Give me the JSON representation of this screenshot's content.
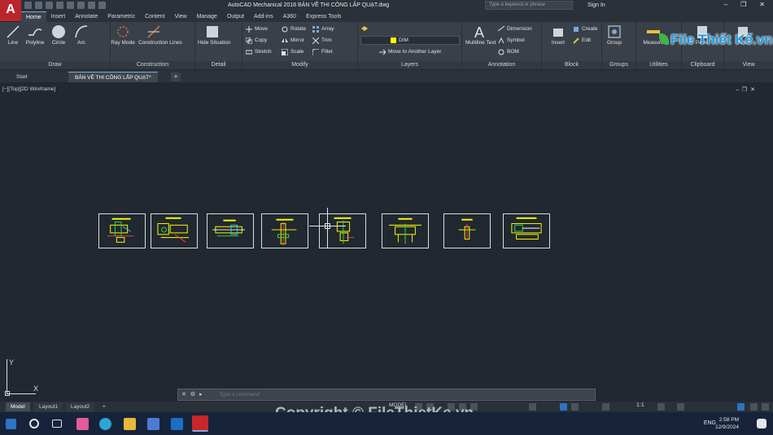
{
  "app": {
    "logo": "A",
    "title": "AutoCAD Mechanical 2018    BẢN VẼ THI CÔNG LẮP QUẠT.dwg",
    "search_placeholder": "Type a keyword or phrase",
    "signin": "Sign In"
  },
  "ribbon_tabs": [
    "Home",
    "Insert",
    "Annotate",
    "Parametric",
    "Content",
    "View",
    "Manage",
    "Output",
    "Add-ins",
    "A360",
    "Express Tools"
  ],
  "ribbon": {
    "draw": {
      "label": "Draw",
      "tools": [
        "Line",
        "Polyline",
        "Circle",
        "Arc"
      ]
    },
    "construction": {
      "label": "Construction",
      "tools": [
        "Ray Mode",
        "Construction Lines"
      ]
    },
    "detail": {
      "label": "Detail",
      "tools": [
        "Hide Situation"
      ]
    },
    "modify": {
      "label": "Modify",
      "tools": [
        "Move",
        "Rotate",
        "Array",
        "Copy",
        "Mirror",
        "Trim",
        "Stretch",
        "Scale",
        "Fillet"
      ]
    },
    "layers": {
      "label": "Layers",
      "current_layer": "DIM",
      "move_tool": "Move to Another Layer"
    },
    "annotation": {
      "label": "Annotation",
      "multiline": "Multiline Text",
      "tools": [
        "Dimension",
        "Symbol",
        "BOM"
      ]
    },
    "block": {
      "label": "Block",
      "insert": "Insert",
      "tools": [
        "Create",
        "Edit"
      ]
    },
    "groups": {
      "label": "Groups",
      "tool": "Group"
    },
    "utilities": {
      "label": "Utilities",
      "tool": "Measure"
    },
    "clipboard": {
      "label": "Clipboard",
      "tool": "Paste"
    },
    "view": {
      "label": "View",
      "tool": "Base"
    }
  },
  "watermark_logo": "File Thiết Kế.vn",
  "file_tabs": [
    "Start",
    "BẢN VẼ THI CÔNG LẮP QUẠT*"
  ],
  "viewport_label": "[−][Top][2D Wireframe]",
  "ucs": {
    "x": "X",
    "y": "Y"
  },
  "command": {
    "placeholder": "Type a command"
  },
  "layout_tabs": [
    "Model",
    "Layout1",
    "Layout2"
  ],
  "status": {
    "model": "MODEL",
    "scale": "1:1"
  },
  "copyright": "Copyright © FileThietKe.vn",
  "taskbar": {
    "lang": "ENG",
    "time": "2:58 PM",
    "date": "12/9/2024"
  },
  "colors": {
    "accent": "#2e73c4",
    "drawing_yellow": "#ffff00",
    "canvas_bg": "#212830",
    "autocad_red": "#b8262c"
  }
}
